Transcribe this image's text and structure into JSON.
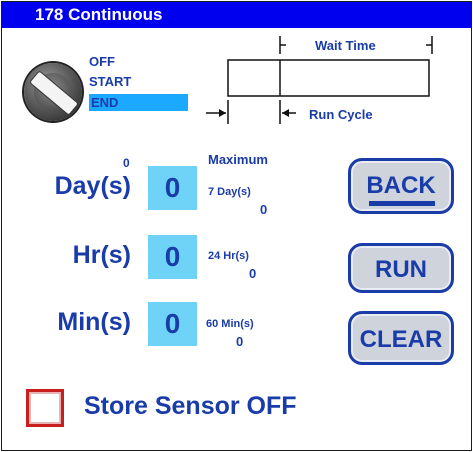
{
  "title": "178  Continuous",
  "modes": [
    "OFF",
    "START",
    "END"
  ],
  "selected_mode": "END",
  "diagram": {
    "wait_time": "Wait Time",
    "run_cycle": "Run Cycle"
  },
  "total_count": "0",
  "maximum_label": "Maximum",
  "rows": [
    {
      "label": "Day(s)",
      "value": "0",
      "max_label": "7 Day(s)",
      "max_value": "0"
    },
    {
      "label": "Hr(s)",
      "value": "0",
      "max_label": "24 Hr(s)",
      "max_value": "0"
    },
    {
      "label": "Min(s)",
      "value": "0",
      "max_label": "60 Min(s)",
      "max_value": "0"
    }
  ],
  "buttons": {
    "back": "BACK",
    "run": "RUN",
    "clear": "CLEAR"
  },
  "store_sensor": {
    "label": "Store Sensor OFF",
    "checked": false
  },
  "icons": {
    "mode_switch": "rotary-switch-icon",
    "checkbox": "checkbox-icon"
  },
  "colors": {
    "title_bar": "#0000ee",
    "text": "#1a3ca8",
    "value_box": "#6fd3f7",
    "selected_mode": "#1ba8ff",
    "checkbox_border": "#c81e1e"
  }
}
